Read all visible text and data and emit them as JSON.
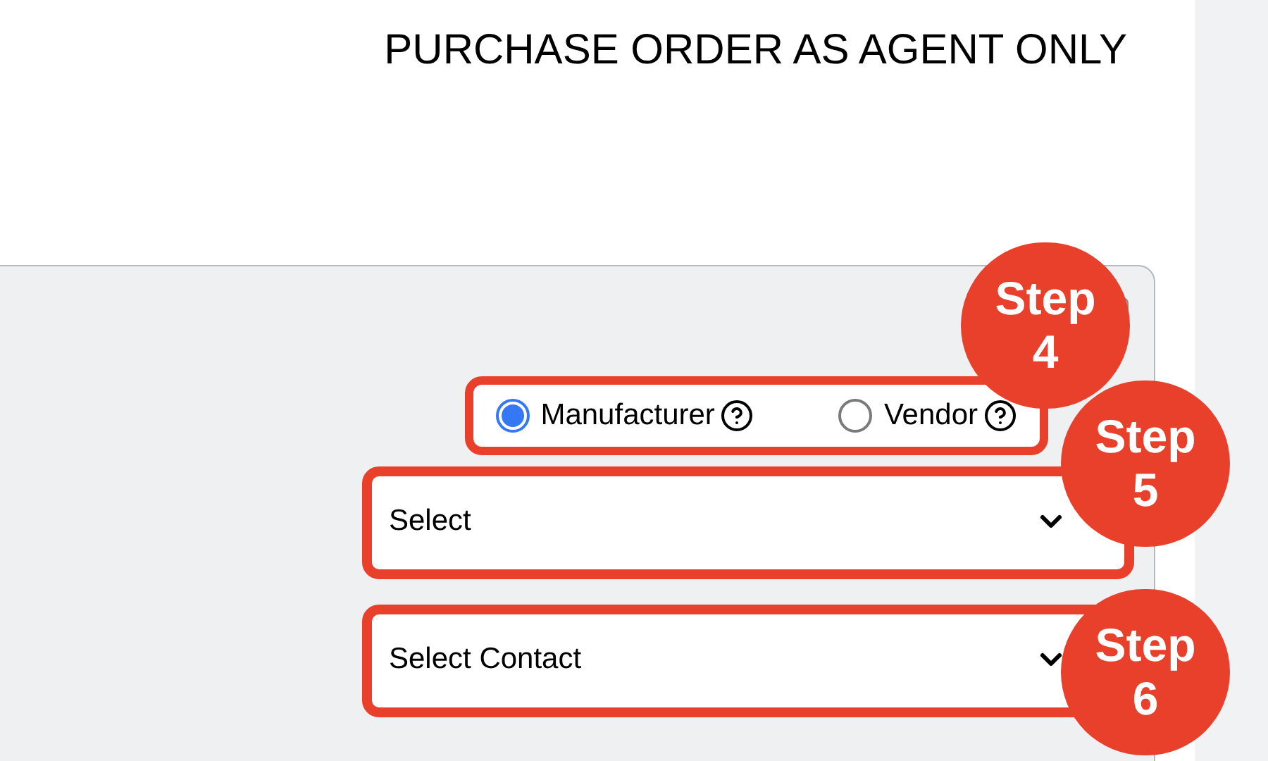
{
  "title": "PURCHASE ORDER AS AGENT ONLY",
  "party_options": [
    {
      "label": "Manufacturer",
      "selected": true
    },
    {
      "label": "Vendor",
      "selected": false
    }
  ],
  "dropdowns": [
    {
      "value": "Select"
    },
    {
      "value": "Select Contact"
    }
  ],
  "step_badges": [
    {
      "word": "Step",
      "number": "4"
    },
    {
      "word": "Step",
      "number": "5"
    },
    {
      "word": "Step",
      "number": "6"
    }
  ]
}
